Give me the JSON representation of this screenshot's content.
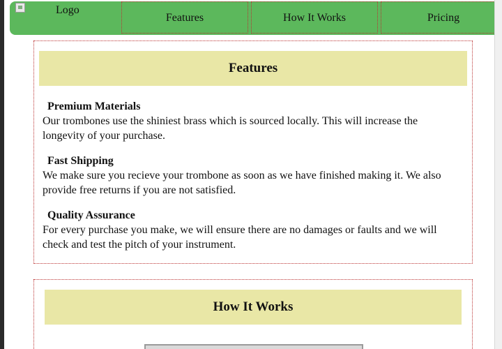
{
  "nav": {
    "logo_text": "Logo",
    "links": [
      {
        "label": "Features"
      },
      {
        "label": "How It Works"
      },
      {
        "label": "Pricing"
      }
    ]
  },
  "features": {
    "title": "Features",
    "items": [
      {
        "title": "Premium Materials",
        "text": "Our trombones use the shiniest brass which is sourced locally. This will increase the longevity of your purchase."
      },
      {
        "title": "Fast Shipping",
        "text": "We make sure you recieve your trombone as soon as we have finished making it. We also provide free returns if you are not satisfied."
      },
      {
        "title": "Quality Assurance",
        "text": "For every purchase you make, we will ensure there are no damages or faults and we will check and test the pitch of your instrument."
      }
    ]
  },
  "how_it_works": {
    "title": "How It Works"
  },
  "colors": {
    "nav_bg": "#5cb85c",
    "header_bg": "#e9e7a6",
    "border": "#b33333"
  }
}
